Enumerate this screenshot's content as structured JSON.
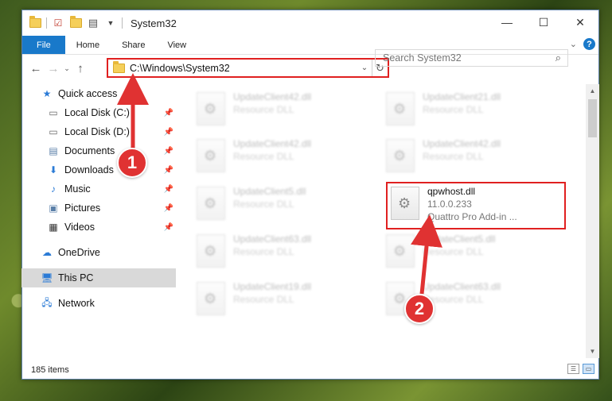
{
  "window": {
    "title": "System32",
    "controls": {
      "minimize": "—",
      "maximize": "☐",
      "close": "✕"
    }
  },
  "ribbon": {
    "tabs": [
      "File",
      "Home",
      "Share",
      "View"
    ],
    "help": "?"
  },
  "address": {
    "path": "C:\\Windows\\System32",
    "search_placeholder": "Search System32"
  },
  "nav": {
    "quick_access": "Quick access",
    "items": [
      {
        "label": "Local Disk (C:)",
        "icon": "drive-icon"
      },
      {
        "label": "Local Disk (D:)",
        "icon": "drive-icon"
      },
      {
        "label": "Documents",
        "icon": "documents-icon"
      },
      {
        "label": "Downloads",
        "icon": "downloads-icon"
      },
      {
        "label": "Music",
        "icon": "music-icon"
      },
      {
        "label": "Pictures",
        "icon": "pictures-icon"
      },
      {
        "label": "Videos",
        "icon": "videos-icon"
      }
    ],
    "onedrive": "OneDrive",
    "this_pc": "This PC",
    "network": "Network"
  },
  "files": [
    {
      "name": "UpdateClient42.dll",
      "desc": "Resource DLL"
    },
    {
      "name": "UpdateClient21.dll",
      "desc": "Resource DLL"
    },
    {
      "name": "UpdateClient42.dll",
      "desc": "Resource DLL"
    },
    {
      "name": "UpdateClient42.dll",
      "desc": "Resource DLL"
    },
    {
      "name": "UpdateClient5.dll",
      "desc": "Resource DLL"
    },
    {
      "name": "qpwhost.dll",
      "version": "11.0.0.233",
      "desc": "Quattro Pro Add-in ..."
    },
    {
      "name": "UpdateClient63.dll",
      "desc": "Resource DLL"
    },
    {
      "name": "UpdateClient5.dll",
      "desc": "Resource DLL"
    },
    {
      "name": "UpdateClient19.dll",
      "desc": "Resource DLL"
    },
    {
      "name": "UpdateClient63.dll",
      "desc": "Resource DLL"
    }
  ],
  "status": {
    "item_count": "185 items"
  },
  "annotations": {
    "step1": "1",
    "step2": "2",
    "color": "#e03232"
  }
}
